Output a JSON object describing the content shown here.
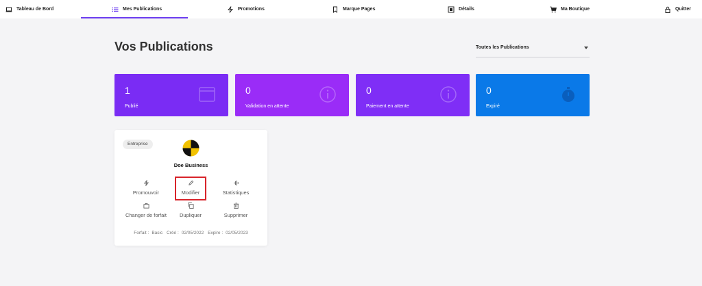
{
  "nav": {
    "items": [
      {
        "label": "Tableau de Bord",
        "icon": "laptop-icon"
      },
      {
        "label": "Mes Publications",
        "icon": "list-icon",
        "active": true
      },
      {
        "label": "Promotions",
        "icon": "bolt-icon"
      },
      {
        "label": "Marque Pages",
        "icon": "bookmark-icon"
      },
      {
        "label": "Détails",
        "icon": "details-icon"
      },
      {
        "label": "Ma Boutique",
        "icon": "cart-icon"
      },
      {
        "label": "Quitter",
        "icon": "lock-icon"
      }
    ]
  },
  "page": {
    "title": "Vos Publications",
    "filter": {
      "selected": "Toutes les Publications"
    }
  },
  "stats": [
    {
      "value": "1",
      "label": "Publié",
      "color": "#7a2cf4",
      "icon": "browser-icon"
    },
    {
      "value": "0",
      "label": "Validation en attente",
      "color": "#9a2cf7",
      "icon": "info-icon"
    },
    {
      "value": "0",
      "label": "Paiement en attente",
      "color": "#7f2ef6",
      "icon": "info-icon"
    },
    {
      "value": "0",
      "label": "Expiré",
      "color": "#0a79e8",
      "icon": "stopwatch-icon"
    }
  ],
  "listing": {
    "badge": "Entreprise",
    "name": "Doe Business",
    "actions": {
      "promote": "Promouvoir",
      "edit": "Modifier",
      "stats": "Statistiques",
      "change_plan": "Changer de forfait",
      "duplicate": "Dupliquer",
      "delete": "Supprimer"
    },
    "meta": {
      "plan_label": "Forfait :",
      "plan": "Basic",
      "created_label": "Créé :",
      "created": "02/05/2022",
      "expires_label": "Expire :",
      "expires": "02/05/2023"
    }
  }
}
